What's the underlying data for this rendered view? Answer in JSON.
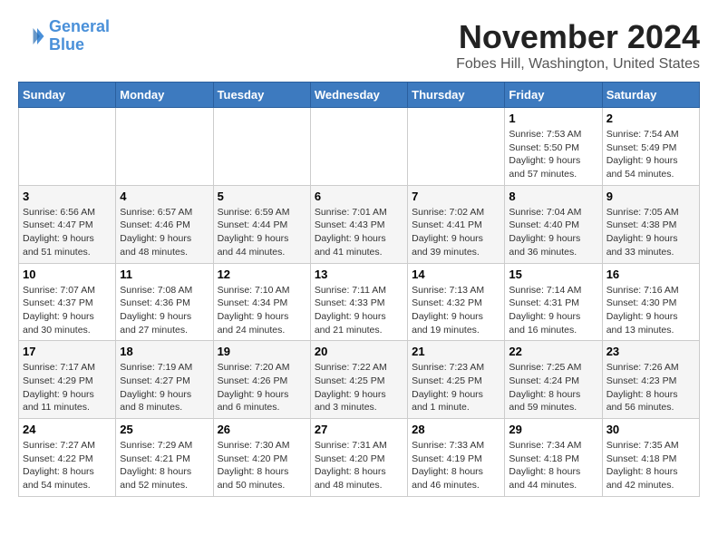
{
  "logo": {
    "line1": "General",
    "line2": "Blue"
  },
  "title": "November 2024",
  "location": "Fobes Hill, Washington, United States",
  "days_of_week": [
    "Sunday",
    "Monday",
    "Tuesday",
    "Wednesday",
    "Thursday",
    "Friday",
    "Saturday"
  ],
  "weeks": [
    [
      {
        "day": "",
        "sunrise": "",
        "sunset": "",
        "daylight": ""
      },
      {
        "day": "",
        "sunrise": "",
        "sunset": "",
        "daylight": ""
      },
      {
        "day": "",
        "sunrise": "",
        "sunset": "",
        "daylight": ""
      },
      {
        "day": "",
        "sunrise": "",
        "sunset": "",
        "daylight": ""
      },
      {
        "day": "",
        "sunrise": "",
        "sunset": "",
        "daylight": ""
      },
      {
        "day": "1",
        "sunrise": "Sunrise: 7:53 AM",
        "sunset": "Sunset: 5:50 PM",
        "daylight": "Daylight: 9 hours and 57 minutes."
      },
      {
        "day": "2",
        "sunrise": "Sunrise: 7:54 AM",
        "sunset": "Sunset: 5:49 PM",
        "daylight": "Daylight: 9 hours and 54 minutes."
      }
    ],
    [
      {
        "day": "3",
        "sunrise": "Sunrise: 6:56 AM",
        "sunset": "Sunset: 4:47 PM",
        "daylight": "Daylight: 9 hours and 51 minutes."
      },
      {
        "day": "4",
        "sunrise": "Sunrise: 6:57 AM",
        "sunset": "Sunset: 4:46 PM",
        "daylight": "Daylight: 9 hours and 48 minutes."
      },
      {
        "day": "5",
        "sunrise": "Sunrise: 6:59 AM",
        "sunset": "Sunset: 4:44 PM",
        "daylight": "Daylight: 9 hours and 44 minutes."
      },
      {
        "day": "6",
        "sunrise": "Sunrise: 7:01 AM",
        "sunset": "Sunset: 4:43 PM",
        "daylight": "Daylight: 9 hours and 41 minutes."
      },
      {
        "day": "7",
        "sunrise": "Sunrise: 7:02 AM",
        "sunset": "Sunset: 4:41 PM",
        "daylight": "Daylight: 9 hours and 39 minutes."
      },
      {
        "day": "8",
        "sunrise": "Sunrise: 7:04 AM",
        "sunset": "Sunset: 4:40 PM",
        "daylight": "Daylight: 9 hours and 36 minutes."
      },
      {
        "day": "9",
        "sunrise": "Sunrise: 7:05 AM",
        "sunset": "Sunset: 4:38 PM",
        "daylight": "Daylight: 9 hours and 33 minutes."
      }
    ],
    [
      {
        "day": "10",
        "sunrise": "Sunrise: 7:07 AM",
        "sunset": "Sunset: 4:37 PM",
        "daylight": "Daylight: 9 hours and 30 minutes."
      },
      {
        "day": "11",
        "sunrise": "Sunrise: 7:08 AM",
        "sunset": "Sunset: 4:36 PM",
        "daylight": "Daylight: 9 hours and 27 minutes."
      },
      {
        "day": "12",
        "sunrise": "Sunrise: 7:10 AM",
        "sunset": "Sunset: 4:34 PM",
        "daylight": "Daylight: 9 hours and 24 minutes."
      },
      {
        "day": "13",
        "sunrise": "Sunrise: 7:11 AM",
        "sunset": "Sunset: 4:33 PM",
        "daylight": "Daylight: 9 hours and 21 minutes."
      },
      {
        "day": "14",
        "sunrise": "Sunrise: 7:13 AM",
        "sunset": "Sunset: 4:32 PM",
        "daylight": "Daylight: 9 hours and 19 minutes."
      },
      {
        "day": "15",
        "sunrise": "Sunrise: 7:14 AM",
        "sunset": "Sunset: 4:31 PM",
        "daylight": "Daylight: 9 hours and 16 minutes."
      },
      {
        "day": "16",
        "sunrise": "Sunrise: 7:16 AM",
        "sunset": "Sunset: 4:30 PM",
        "daylight": "Daylight: 9 hours and 13 minutes."
      }
    ],
    [
      {
        "day": "17",
        "sunrise": "Sunrise: 7:17 AM",
        "sunset": "Sunset: 4:29 PM",
        "daylight": "Daylight: 9 hours and 11 minutes."
      },
      {
        "day": "18",
        "sunrise": "Sunrise: 7:19 AM",
        "sunset": "Sunset: 4:27 PM",
        "daylight": "Daylight: 9 hours and 8 minutes."
      },
      {
        "day": "19",
        "sunrise": "Sunrise: 7:20 AM",
        "sunset": "Sunset: 4:26 PM",
        "daylight": "Daylight: 9 hours and 6 minutes."
      },
      {
        "day": "20",
        "sunrise": "Sunrise: 7:22 AM",
        "sunset": "Sunset: 4:25 PM",
        "daylight": "Daylight: 9 hours and 3 minutes."
      },
      {
        "day": "21",
        "sunrise": "Sunrise: 7:23 AM",
        "sunset": "Sunset: 4:25 PM",
        "daylight": "Daylight: 9 hours and 1 minute."
      },
      {
        "day": "22",
        "sunrise": "Sunrise: 7:25 AM",
        "sunset": "Sunset: 4:24 PM",
        "daylight": "Daylight: 8 hours and 59 minutes."
      },
      {
        "day": "23",
        "sunrise": "Sunrise: 7:26 AM",
        "sunset": "Sunset: 4:23 PM",
        "daylight": "Daylight: 8 hours and 56 minutes."
      }
    ],
    [
      {
        "day": "24",
        "sunrise": "Sunrise: 7:27 AM",
        "sunset": "Sunset: 4:22 PM",
        "daylight": "Daylight: 8 hours and 54 minutes."
      },
      {
        "day": "25",
        "sunrise": "Sunrise: 7:29 AM",
        "sunset": "Sunset: 4:21 PM",
        "daylight": "Daylight: 8 hours and 52 minutes."
      },
      {
        "day": "26",
        "sunrise": "Sunrise: 7:30 AM",
        "sunset": "Sunset: 4:20 PM",
        "daylight": "Daylight: 8 hours and 50 minutes."
      },
      {
        "day": "27",
        "sunrise": "Sunrise: 7:31 AM",
        "sunset": "Sunset: 4:20 PM",
        "daylight": "Daylight: 8 hours and 48 minutes."
      },
      {
        "day": "28",
        "sunrise": "Sunrise: 7:33 AM",
        "sunset": "Sunset: 4:19 PM",
        "daylight": "Daylight: 8 hours and 46 minutes."
      },
      {
        "day": "29",
        "sunrise": "Sunrise: 7:34 AM",
        "sunset": "Sunset: 4:18 PM",
        "daylight": "Daylight: 8 hours and 44 minutes."
      },
      {
        "day": "30",
        "sunrise": "Sunrise: 7:35 AM",
        "sunset": "Sunset: 4:18 PM",
        "daylight": "Daylight: 8 hours and 42 minutes."
      }
    ]
  ]
}
